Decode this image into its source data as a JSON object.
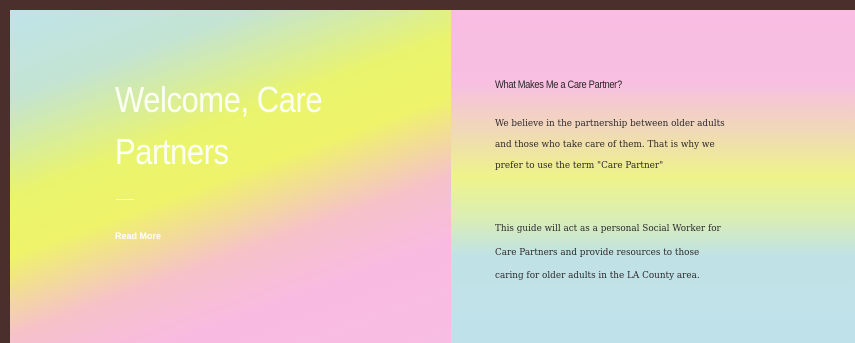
{
  "hero": {
    "title": "Welcome, Care Partners",
    "read_more_label": "Read More"
  },
  "info": {
    "heading": "What Makes Me a Care Partner?",
    "paragraph_1": "We believe in the partnership between older adults and those who take care of them. That is why we prefer to use the term \"Care Partner\"",
    "paragraph_2": "This guide will act as a personal Social Worker for Care Partners and provide resources to those caring for older adults in the LA County area."
  }
}
